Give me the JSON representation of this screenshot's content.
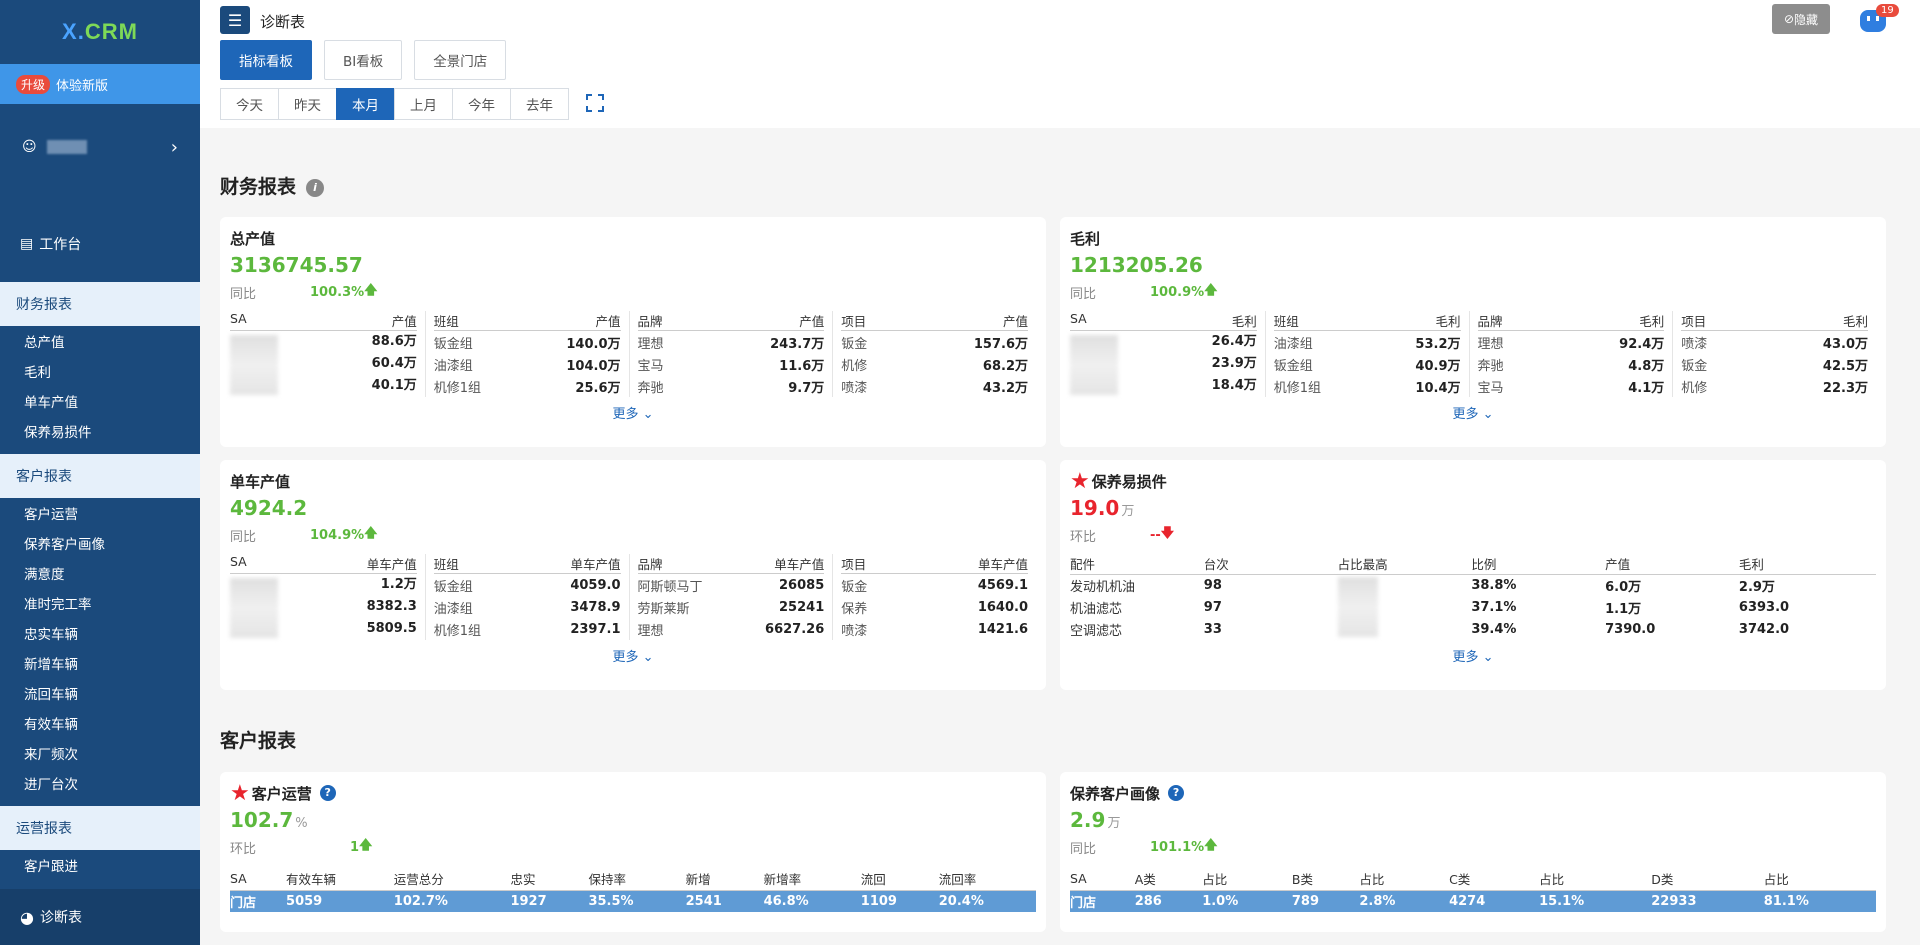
{
  "sidebar": {
    "logo": "X.CRM",
    "upgrade_tag": "升级",
    "upgrade_label": "体验新版",
    "workbench": "工作台",
    "sections": [
      {
        "title": "财务报表",
        "items": [
          "总产值",
          "毛利",
          "单车产值",
          "保养易损件"
        ]
      },
      {
        "title": "客户报表",
        "items": [
          "客户运营",
          "保养客户画像",
          "满意度",
          "准时完工率",
          "忠实车辆",
          "新增车辆",
          "流回车辆",
          "有效车辆",
          "来厂频次",
          "进厂台次"
        ]
      },
      {
        "title": "运营报表",
        "items": [
          "客户跟进"
        ]
      }
    ],
    "bottom": "诊断表"
  },
  "header": {
    "title": "诊断表",
    "hide_label": "隐藏",
    "robot_badge": "19",
    "view_tabs": [
      "指标看板",
      "BI看板",
      "全景门店"
    ],
    "date_tabs": [
      "今天",
      "昨天",
      "本月",
      "上月",
      "今年",
      "去年"
    ],
    "active_date": "本月"
  },
  "finance": {
    "title": "财务报表",
    "total": {
      "title": "总产值",
      "value": "3136745.57",
      "cmp_label": "同比",
      "cmp_value": "100.3%",
      "sa": {
        "head": [
          "SA",
          "产值"
        ],
        "values": [
          "88.6万",
          "60.4万",
          "40.1万"
        ]
      },
      "group": {
        "head": [
          "班组",
          "产值"
        ],
        "rows": [
          [
            "钣金组",
            "140.0万"
          ],
          [
            "油漆组",
            "104.0万"
          ],
          [
            "机修1组",
            "25.6万"
          ]
        ]
      },
      "brand": {
        "head": [
          "品牌",
          "产值"
        ],
        "rows": [
          [
            "理想",
            "243.7万"
          ],
          [
            "宝马",
            "11.6万"
          ],
          [
            "奔驰",
            "9.7万"
          ]
        ]
      },
      "item": {
        "head": [
          "项目",
          "产值"
        ],
        "rows": [
          [
            "钣金",
            "157.6万"
          ],
          [
            "机修",
            "68.2万"
          ],
          [
            "喷漆",
            "43.2万"
          ]
        ]
      },
      "more": "更多"
    },
    "profit": {
      "title": "毛利",
      "value": "1213205.26",
      "cmp_label": "同比",
      "cmp_value": "100.9%",
      "sa": {
        "head": [
          "SA",
          "毛利"
        ],
        "values": [
          "26.4万",
          "23.9万",
          "18.4万"
        ]
      },
      "group": {
        "head": [
          "班组",
          "毛利"
        ],
        "rows": [
          [
            "油漆组",
            "53.2万"
          ],
          [
            "钣金组",
            "40.9万"
          ],
          [
            "机修1组",
            "10.4万"
          ]
        ]
      },
      "brand": {
        "head": [
          "品牌",
          "毛利"
        ],
        "rows": [
          [
            "理想",
            "92.4万"
          ],
          [
            "奔驰",
            "4.8万"
          ],
          [
            "宝马",
            "4.1万"
          ]
        ]
      },
      "item": {
        "head": [
          "项目",
          "毛利"
        ],
        "rows": [
          [
            "喷漆",
            "43.0万"
          ],
          [
            "钣金",
            "42.5万"
          ],
          [
            "机修",
            "22.3万"
          ]
        ]
      },
      "more": "更多"
    },
    "per_car": {
      "title": "单车产值",
      "value": "4924.2",
      "cmp_label": "同比",
      "cmp_value": "104.9%",
      "sa": {
        "head": [
          "SA",
          "单车产值"
        ],
        "values": [
          "1.2万",
          "8382.3",
          "5809.5"
        ]
      },
      "group": {
        "head": [
          "班组",
          "单车产值"
        ],
        "rows": [
          [
            "钣金组",
            "4059.0"
          ],
          [
            "油漆组",
            "3478.9"
          ],
          [
            "机修1组",
            "2397.1"
          ]
        ]
      },
      "brand": {
        "head": [
          "品牌",
          "单车产值"
        ],
        "rows": [
          [
            "阿斯顿马丁",
            "26085"
          ],
          [
            "劳斯莱斯",
            "25241"
          ],
          [
            "理想",
            "6627.26"
          ]
        ]
      },
      "item": {
        "head": [
          "项目",
          "单车产值"
        ],
        "rows": [
          [
            "钣金",
            "4569.1"
          ],
          [
            "保养",
            "1640.0"
          ],
          [
            "喷漆",
            "1421.6"
          ]
        ]
      },
      "more": "更多"
    },
    "parts": {
      "title": "保养易损件",
      "value": "19.0",
      "unit": "万",
      "cmp_label": "环比",
      "cmp_value": "--",
      "head": [
        "配件",
        "台次",
        "占比最高",
        "比例",
        "产值",
        "毛利"
      ],
      "rows": [
        [
          "发动机机油",
          "98",
          "38.8%",
          "6.0万",
          "2.9万"
        ],
        [
          "机油滤芯",
          "97",
          "37.1%",
          "1.1万",
          "6393.0"
        ],
        [
          "空调滤芯",
          "33",
          "39.4%",
          "7390.0",
          "3742.0"
        ]
      ],
      "more": "更多"
    }
  },
  "customer": {
    "title": "客户报表",
    "ops": {
      "title": "客户运营",
      "value": "102.7",
      "unit": "%",
      "cmp_label": "环比",
      "cmp_value": "1",
      "head": [
        "SA",
        "有效车辆",
        "运营总分",
        "忠实",
        "保持率",
        "新增",
        "新增率",
        "流回",
        "流回率"
      ],
      "row": [
        "门店",
        "5059",
        "102.7%",
        "1927",
        "35.5%",
        "2541",
        "46.8%",
        "1109",
        "20.4%"
      ]
    },
    "portrait": {
      "title": "保养客户画像",
      "value": "2.9",
      "unit": "万",
      "cmp_label": "同比",
      "cmp_value": "101.1%",
      "head": [
        "SA",
        "A类",
        "占比",
        "B类",
        "占比",
        "C类",
        "占比",
        "D类",
        "占比"
      ],
      "row": [
        "门店",
        "286",
        "1.0%",
        "789",
        "2.8%",
        "4274",
        "15.1%",
        "22933",
        "81.1%"
      ]
    }
  },
  "colors": {
    "sidebar": "#1b4a7c",
    "accent": "#1e66b8",
    "positive": "#5cb83d",
    "negative": "#e8242d"
  }
}
